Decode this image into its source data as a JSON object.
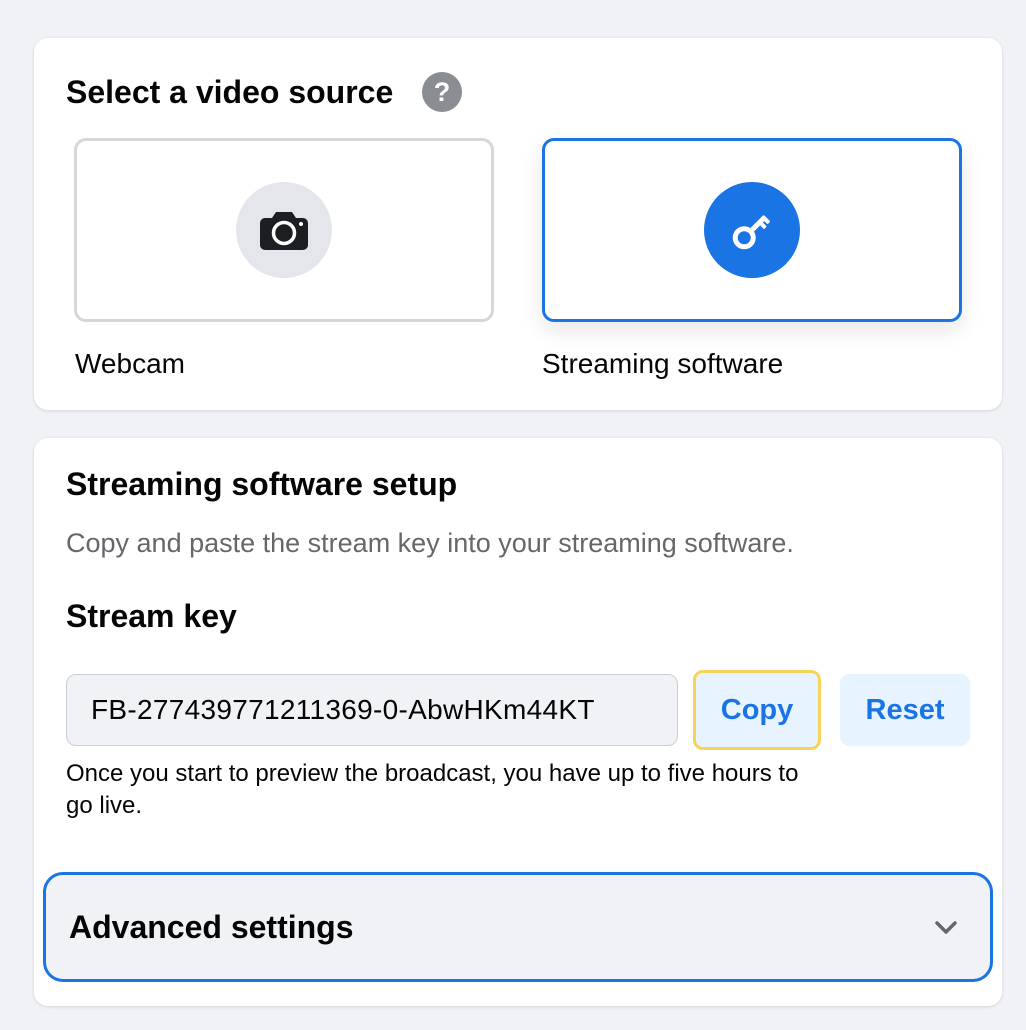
{
  "video_source": {
    "title": "Select a video source",
    "help_icon": "?",
    "options": [
      {
        "label": "Webcam",
        "icon": "camera-icon",
        "selected": false
      },
      {
        "label": "Streaming software",
        "icon": "key-icon",
        "selected": true
      }
    ]
  },
  "setup": {
    "title": "Streaming software setup",
    "description": "Copy and paste the stream key into your streaming software.",
    "stream_key_title": "Stream key",
    "stream_key_value": "FB-277439771211369-0-AbwHKm44KT",
    "copy_label": "Copy",
    "reset_label": "Reset",
    "note": "Once you start to preview the broadcast, you have up to five hours to go live.",
    "advanced_label": "Advanced settings"
  },
  "colors": {
    "accent": "#1b74e4",
    "focus_ring": "#f7d35b",
    "background": "#f0f2f5",
    "secondary_text": "#65676b"
  }
}
